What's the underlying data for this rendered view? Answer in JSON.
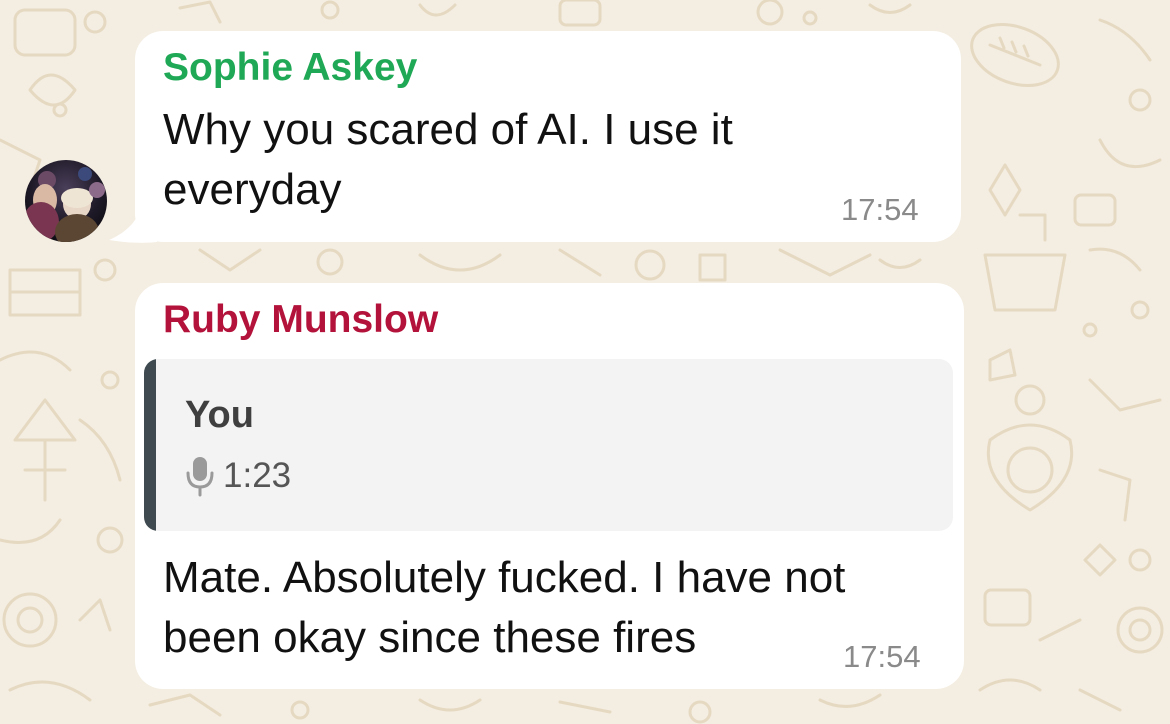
{
  "messages": [
    {
      "sender": "Sophie Askey",
      "sender_color": "#1fa855",
      "text": "Why you scared of AI. I use it everyday",
      "time": "17:54"
    },
    {
      "sender": "Ruby Munslow",
      "sender_color": "#b3123a",
      "reply": {
        "author": "You",
        "icon": "microphone-icon",
        "duration": "1:23"
      },
      "text": "Mate. Absolutely fucked. I have not been okay since these fires",
      "time": "17:54"
    }
  ],
  "colors": {
    "background": "#f4ede1",
    "bubble": "#ffffff",
    "timestamp": "#8a8a8a",
    "quote_background": "#f3f3f3",
    "quote_bar": "#3e4a4f"
  }
}
